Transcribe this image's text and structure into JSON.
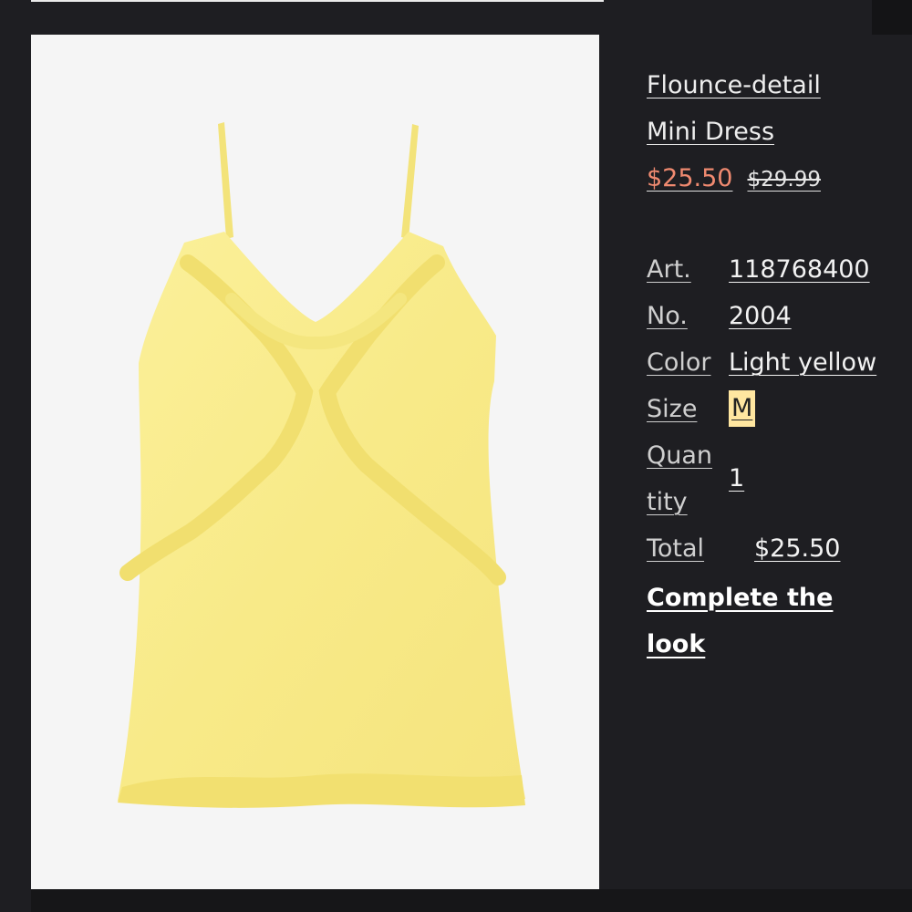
{
  "product": {
    "title_line1": "Flounce-detail",
    "title_line2": "Mini Dress",
    "sale_price": "$25.50",
    "original_price": "$29.99"
  },
  "details": {
    "art_label_1": "Art.",
    "art_label_2": "No.",
    "art_value_1": "118768400",
    "art_value_2": "2004",
    "color_label": "Color",
    "color_value": "Light yellow",
    "size_label": "Size",
    "size_value": "M",
    "quantity_label_1": "Quan",
    "quantity_label_2": "tity",
    "quantity_value": "1",
    "total_label": "Total",
    "total_value": "$25.50"
  },
  "cta": {
    "line1": "Complete the",
    "line2": "look"
  },
  "colors": {
    "background": "#1e1e22",
    "sale_price": "#f08a70",
    "size_highlight": "#ffe6a0",
    "dress": "#f9ec8e"
  }
}
